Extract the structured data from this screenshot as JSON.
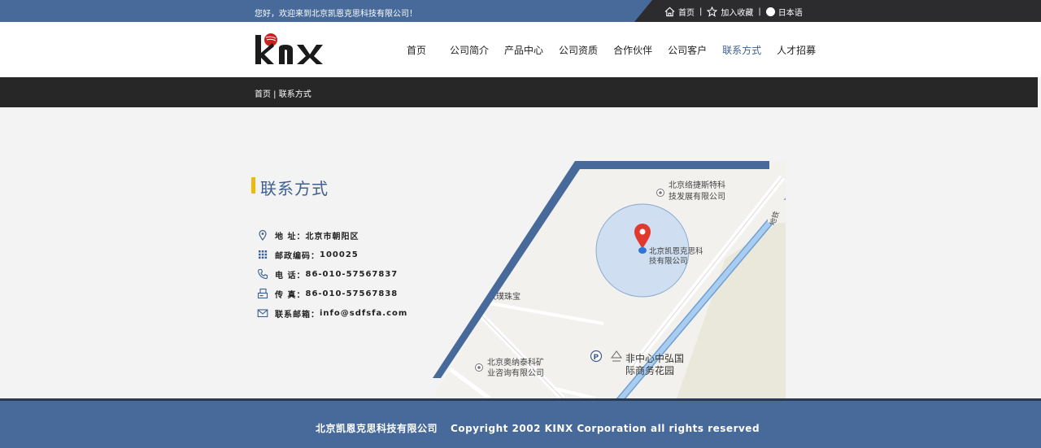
{
  "topbar": {
    "welcome": "您好，欢迎来到北京凯恩克思科技有限公司！",
    "links": [
      "首页",
      "加入收藏",
      "日本语"
    ],
    "sep": "|"
  },
  "header": {
    "logo_text": "KINX",
    "nav": [
      "首页",
      "公司简介",
      "产品中心",
      "公司资质",
      "合作伙伴",
      "公司客户",
      "联系方式",
      "人才招募"
    ],
    "active_nav": "联系方式"
  },
  "breadcrumb": "首页 | 联系方式",
  "contact": {
    "title": "联系方式",
    "items": [
      {
        "label": "地 址：",
        "value": "北京市朝阳区",
        "icon": "location-icon"
      },
      {
        "label": "邮政编码：",
        "value": "100025",
        "icon": "grid-icon"
      },
      {
        "label": "电 话：",
        "value": "86-010-57567837",
        "icon": "phone-icon"
      },
      {
        "label": "传 真：",
        "value": "86-010-57567838",
        "icon": "fax-icon"
      },
      {
        "label": "联系邮箱：",
        "value": "info@sdfsfa.com",
        "icon": "mail-icon"
      }
    ]
  },
  "map": {
    "labels": {
      "poi1": "北京络捷斯特科",
      "poi1b": "技发展有限公司",
      "company": "北京凯恩克思科",
      "companyb": "技有限公司",
      "jewel": "秋璞珠宝",
      "poi2": "北京奥纳泰科矿",
      "poi2b": "业咨询有限公司",
      "garden": "非中心中弘国",
      "gardenb": "际商务花园",
      "parking": "P",
      "road": "地铁"
    },
    "colors": {
      "stripe": "#476a9a",
      "pin": "#e03a2f",
      "water": "#9cc7ef",
      "circle": "#cfdff1"
    }
  },
  "footer": {
    "company": "北京凯恩克思科技有限公司",
    "copyright": "Copyright 2002 KINX Corporation all rights reserved"
  }
}
